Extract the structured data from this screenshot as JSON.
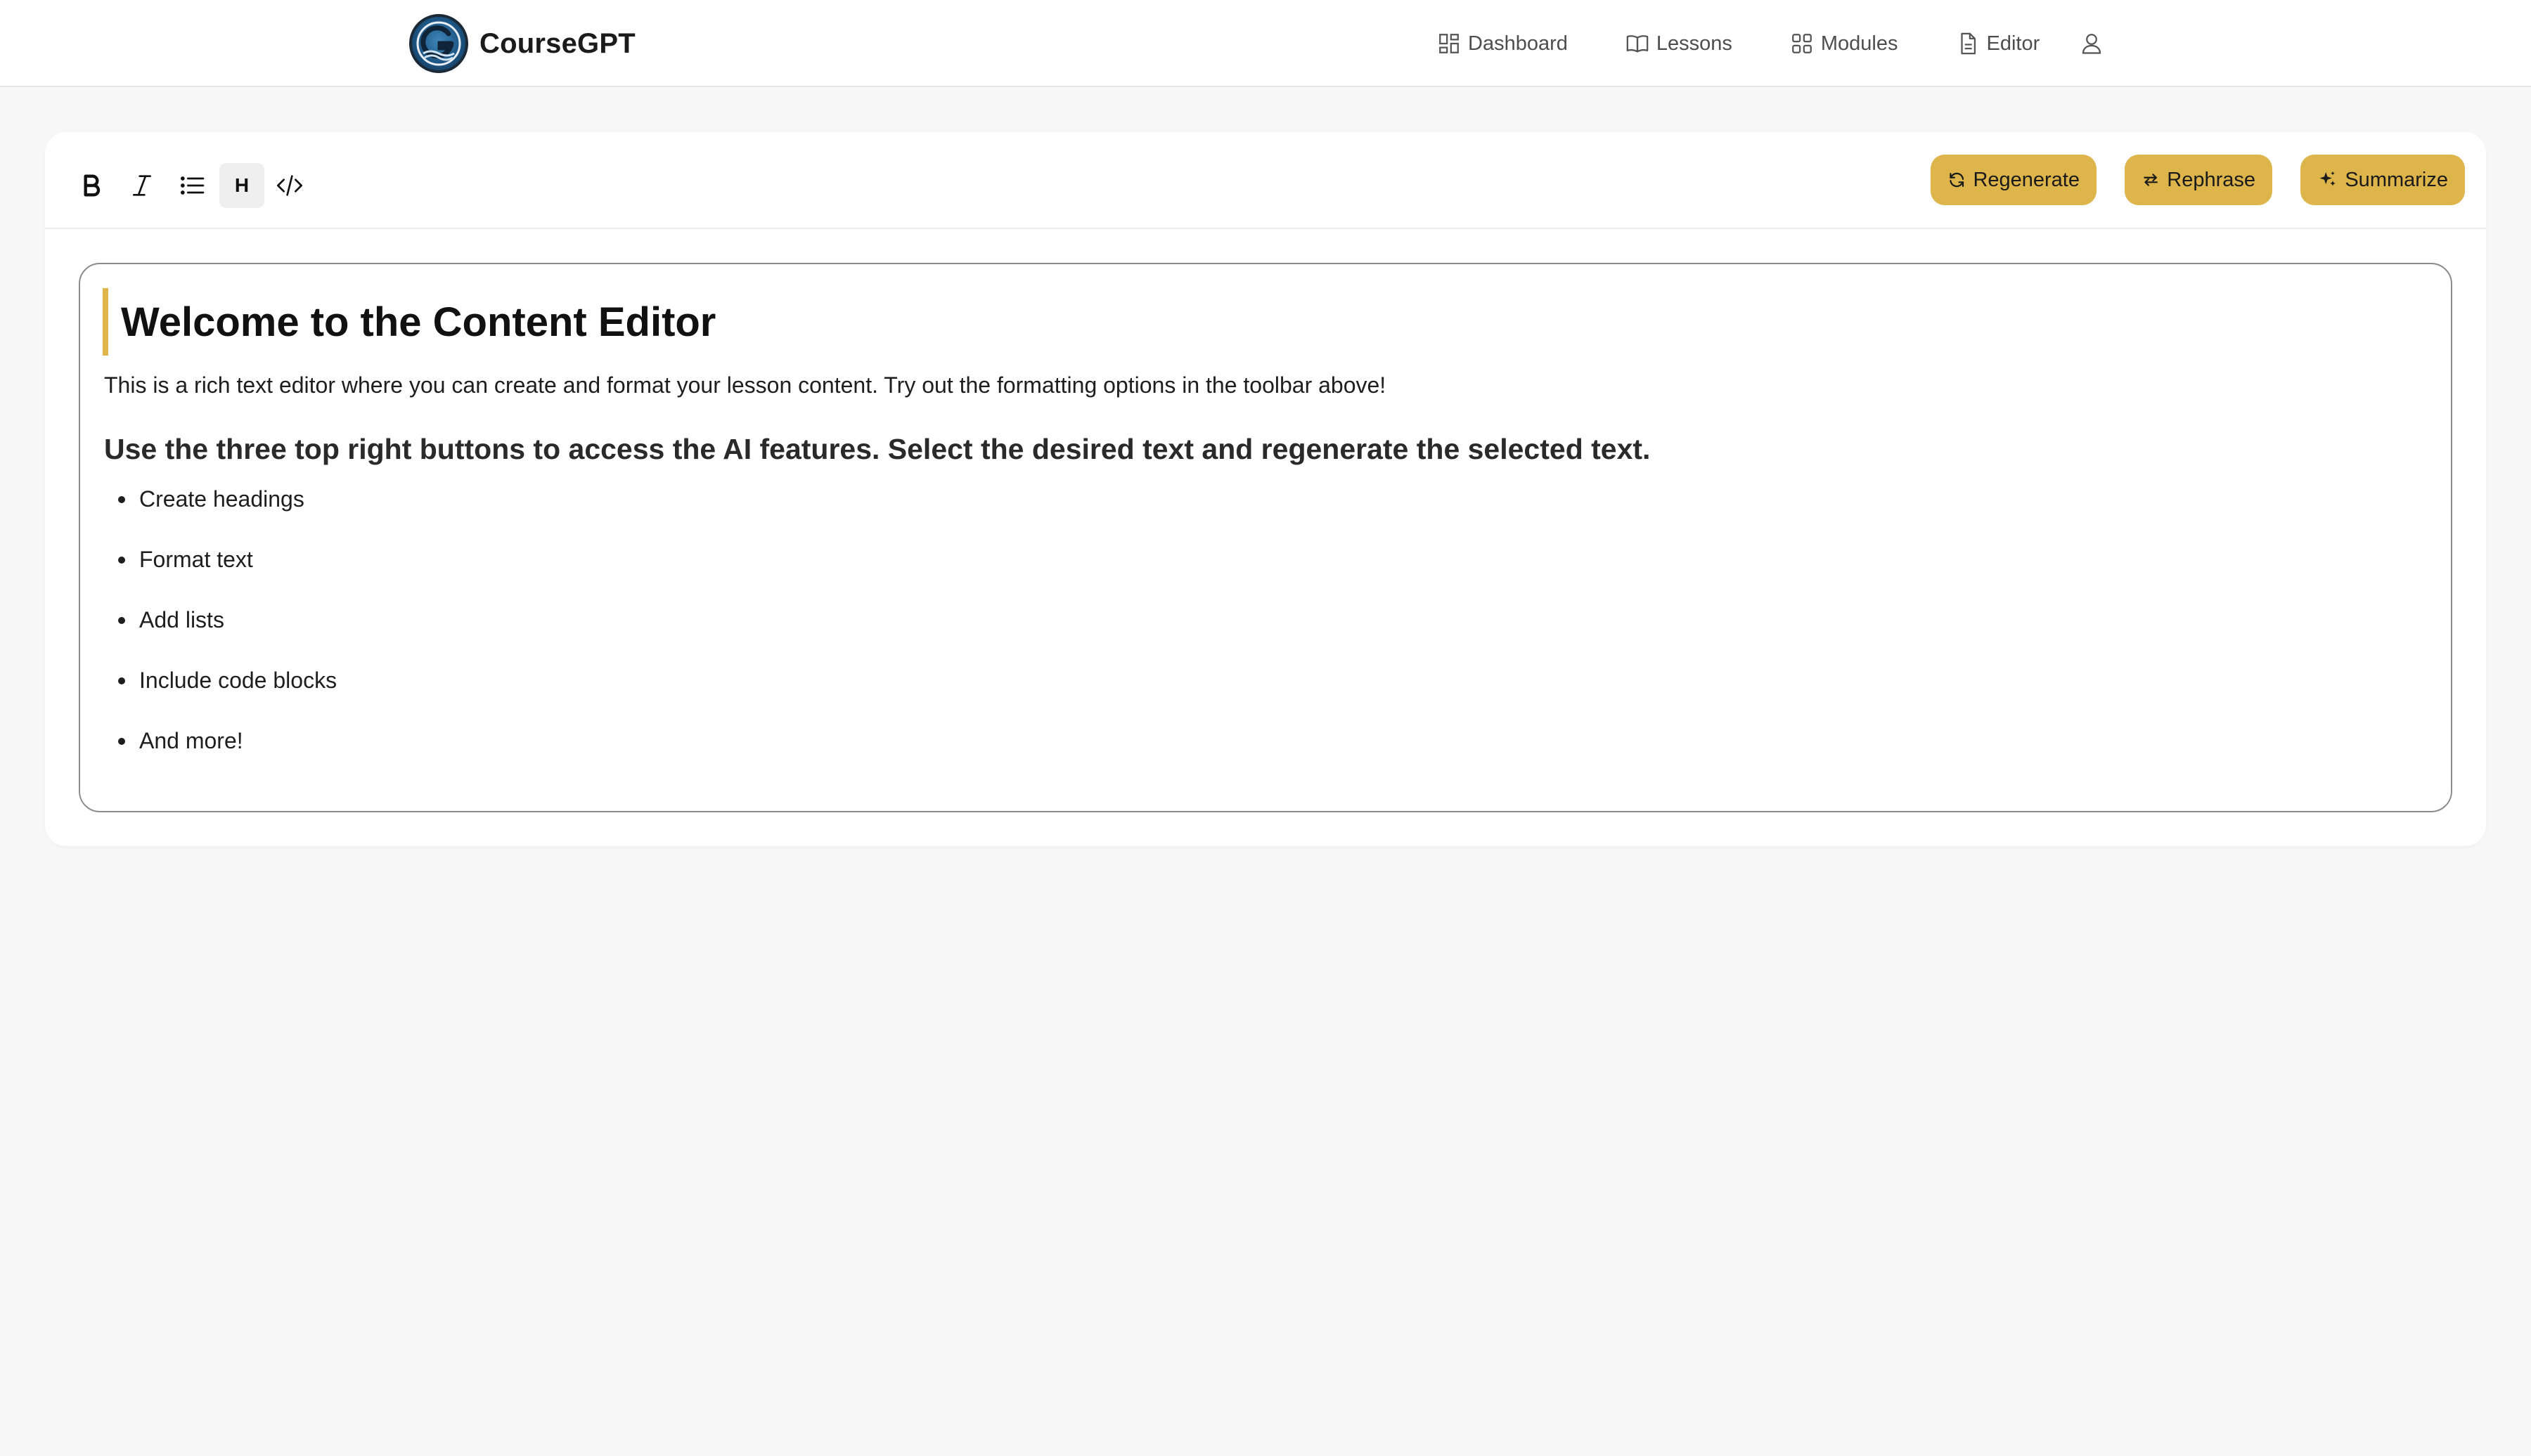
{
  "app": {
    "brand_name": "CourseGPT"
  },
  "nav": {
    "items": [
      {
        "label": "Dashboard",
        "icon": "dashboard-icon"
      },
      {
        "label": "Lessons",
        "icon": "book-icon"
      },
      {
        "label": "Modules",
        "icon": "grid-icon"
      },
      {
        "label": "Editor",
        "icon": "document-icon"
      }
    ],
    "user_icon": "user-icon"
  },
  "toolbar": {
    "format_tools": [
      {
        "name": "bold",
        "icon": "bold-icon"
      },
      {
        "name": "italic",
        "icon": "italic-icon"
      },
      {
        "name": "bullet-list",
        "icon": "list-icon"
      },
      {
        "name": "heading",
        "icon": "heading-icon",
        "label": "H",
        "active": true
      },
      {
        "name": "code",
        "icon": "code-icon"
      }
    ],
    "ai_buttons": [
      {
        "label": "Regenerate",
        "icon": "refresh-icon"
      },
      {
        "label": "Rephrase",
        "icon": "swap-icon"
      },
      {
        "label": "Summarize",
        "icon": "sparkles-icon"
      }
    ],
    "accent_color": "#ddb54b"
  },
  "editor": {
    "heading": "Welcome to the Content Editor",
    "paragraph": "This is a rich text editor where you can create and format your lesson content. Try out the formatting options in the toolbar above!",
    "subheading": "Use the three top right buttons to access the AI features. Select the desired text and regenerate the selected text.",
    "list_items": [
      "Create headings",
      "Format text",
      "Add lists",
      "Include code blocks",
      "And more!"
    ]
  }
}
